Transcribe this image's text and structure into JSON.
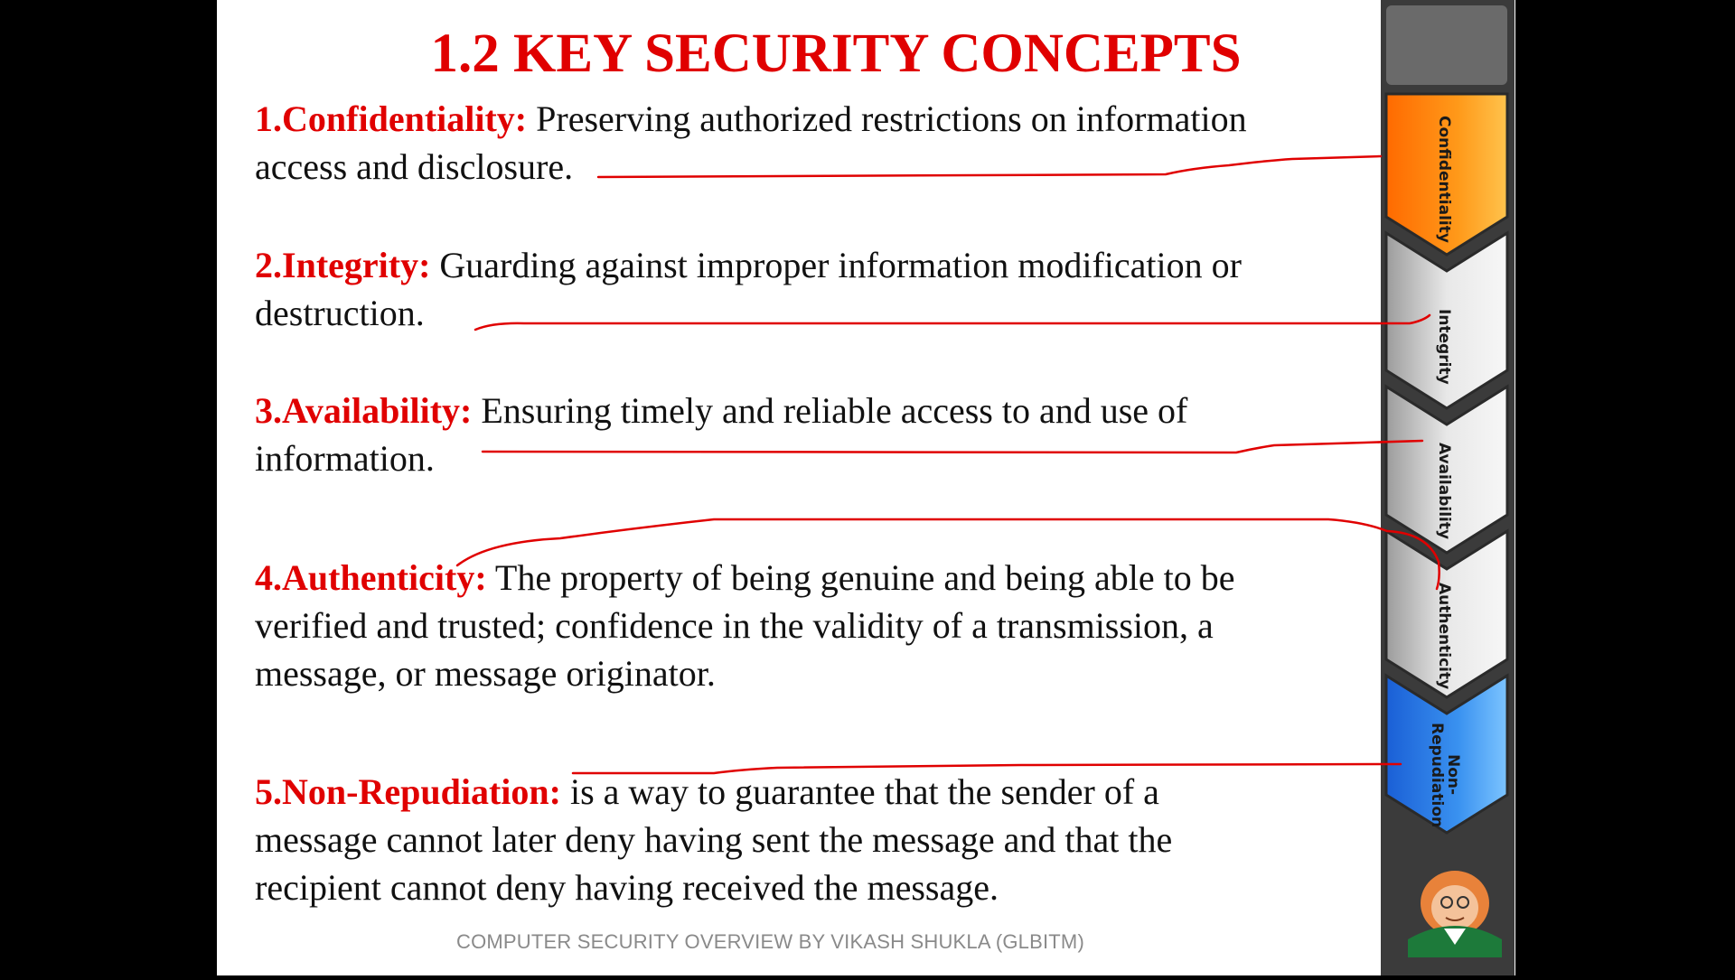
{
  "slide": {
    "title": "1.2 KEY SECURITY CONCEPTS",
    "concepts": [
      {
        "term": "1.Confidentiality:",
        "line1": " Preserving authorized restrictions on information",
        "line2": "access and disclosure."
      },
      {
        "term": "2.Integrity:",
        "line1": " Guarding against improper information modification or",
        "line2": "destruction."
      },
      {
        "term": "3.Availability:",
        "line1": " Ensuring timely and reliable access to and use of",
        "line2": "information."
      },
      {
        "term": "4.Authenticity:",
        "line1": " The property of being genuine and being able to be",
        "line2": "verified and trusted; confidence in the validity of a transmission, a",
        "line3": "message, or message originator."
      },
      {
        "term": "5.Non-Repudiation:",
        "line1": " is a way to guarantee that the sender of a",
        "line2": "message cannot later deny having sent the message and that the",
        "line3": "recipient cannot deny having received the message."
      }
    ],
    "footer": "COMPUTER SECURITY OVERVIEW BY VIKASH SHUKLA (GLBITM)"
  },
  "sidebar": {
    "tabs": [
      {
        "label": "Confidentiality",
        "color": "#ff7a00"
      },
      {
        "label": "Integrity",
        "color": "#d9d9d9"
      },
      {
        "label": "Availability",
        "color": "#d9d9d9"
      },
      {
        "label": "Authenticity",
        "color": "#d9d9d9"
      },
      {
        "label_line1": "Non-",
        "label_line2": "Repudiation",
        "color": "#2f7fe8"
      }
    ],
    "avatar": "cartoon-avatar-icon"
  },
  "colors": {
    "accent": "#e00000",
    "annotation": "#e00000",
    "footer": "#8a8a8a"
  }
}
